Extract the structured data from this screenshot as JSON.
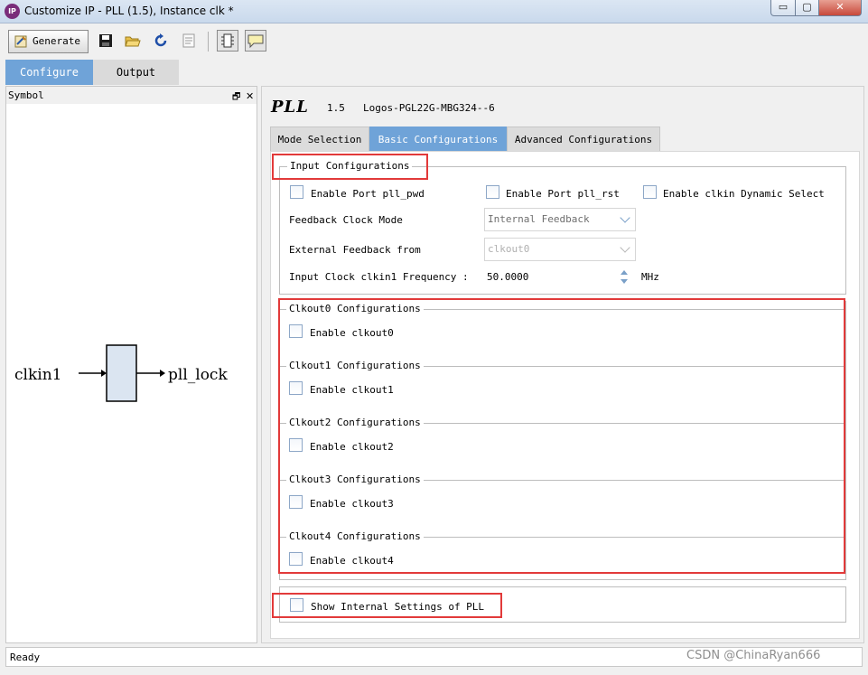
{
  "window": {
    "icon_text": "IP",
    "title": "Customize IP - PLL (1.5), Instance clk *",
    "minimize": "▭",
    "maximize": "▢",
    "close": "✕"
  },
  "toolbar": {
    "generate_label": "Generate"
  },
  "main_tabs": {
    "configure": "Configure",
    "output": "Output"
  },
  "symbol": {
    "header": "Symbol",
    "float_icon": "🗗",
    "close_icon": "✕",
    "input_port": "clkin1",
    "output_port": "pll_lock"
  },
  "ip": {
    "name": "PLL",
    "version": "1.5",
    "device": "Logos-PGL22G-MBG324--6"
  },
  "sub_tabs": {
    "mode": "Mode Selection",
    "basic": "Basic Configurations",
    "advanced": "Advanced Configurations"
  },
  "input_config": {
    "title": "Input Configurations",
    "enable_pwd": "Enable Port pll_pwd",
    "enable_rst": "Enable Port pll_rst",
    "enable_dyn": "Enable clkin Dynamic Select",
    "feedback_mode_label": "Feedback Clock Mode",
    "feedback_mode_value": "Internal Feedback",
    "ext_feedback_label": "External Feedback from",
    "ext_feedback_value": "clkout0",
    "freq_label": "Input Clock clkin1 Frequency :",
    "freq_value": "50.0000",
    "freq_unit": "MHz"
  },
  "clkouts": [
    {
      "title": "Clkout0 Configurations",
      "enable": "Enable clkout0"
    },
    {
      "title": "Clkout1 Configurations",
      "enable": "Enable clkout1"
    },
    {
      "title": "Clkout2 Configurations",
      "enable": "Enable clkout2"
    },
    {
      "title": "Clkout3 Configurations",
      "enable": "Enable clkout3"
    },
    {
      "title": "Clkout4 Configurations",
      "enable": "Enable clkout4"
    }
  ],
  "internal": {
    "show_label": "Show Internal Settings of PLL"
  },
  "status": {
    "text": "Ready"
  },
  "watermark": "CSDN @ChinaRyan666",
  "colors": {
    "accent_tab": "#6fa3d8",
    "highlight": "#e23a3a"
  }
}
